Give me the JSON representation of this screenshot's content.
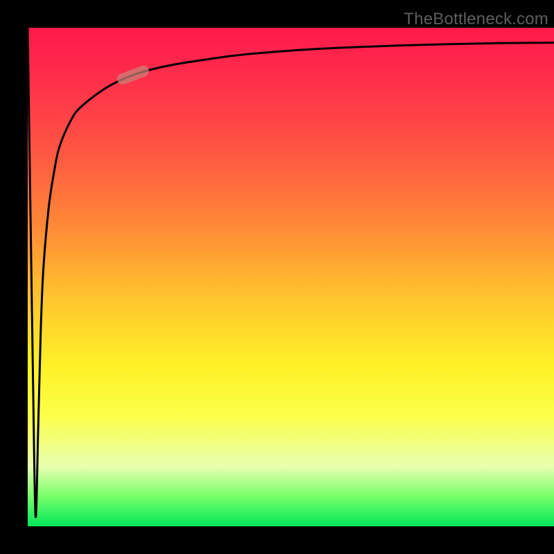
{
  "attribution": "TheBottleneck.com",
  "colors": {
    "frame": "#000000",
    "attribution_text": "#5e5e5e",
    "curve": "#000000",
    "marker": "rgba(200,130,120,0.72)"
  },
  "chart_data": {
    "type": "line",
    "title": "",
    "xlabel": "",
    "ylabel": "",
    "xlim": [
      0,
      100
    ],
    "ylim": [
      0,
      100
    ],
    "grid": false,
    "legend": false,
    "series": [
      {
        "name": "bottleneck-curve",
        "x": [
          0,
          1,
          1.5,
          2,
          2.5,
          3,
          4,
          5,
          6,
          8,
          10,
          15,
          20,
          25,
          30,
          40,
          50,
          60,
          70,
          80,
          90,
          100
        ],
        "y": [
          100,
          30,
          2,
          20,
          40,
          52,
          64,
          71,
          76,
          81,
          84,
          88,
          90.5,
          92,
          93,
          94.5,
          95.4,
          96,
          96.4,
          96.7,
          96.9,
          97
        ]
      }
    ],
    "marker": {
      "series": "bottleneck-curve",
      "x": 20,
      "y": 90.5,
      "shape": "capsule"
    },
    "background_gradient_ylim": [
      0,
      100
    ],
    "background_description": "vertical gradient from red(top) through orange/yellow to green(bottom)"
  }
}
